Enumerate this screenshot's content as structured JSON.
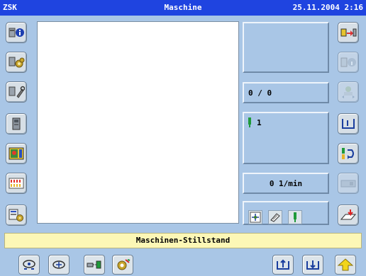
{
  "titlebar": {
    "app": "ZSK",
    "title": "Maschine",
    "datetime": "25.11.2004  2:16"
  },
  "panels": {
    "counter": "0 / 0",
    "needle": "1",
    "speed": "0 1/min"
  },
  "status": "Maschinen-Stillstand",
  "icons": {
    "left": [
      "machine-info-icon",
      "machine-gears-icon",
      "machine-service-icon",
      "memory-card-icon",
      "design-colors-icon",
      "color-sequence-icon",
      "design-settings-icon"
    ],
    "right": [
      "transfer-design-icon",
      "head-info-icon",
      "frame-move-icon",
      "frame-lower-icon",
      "thread-change-icon",
      "boring-device-icon",
      "start-embroidery-icon"
    ],
    "bottom": [
      "frame-center-icon",
      "frame-origin-icon",
      "needle-move-icon",
      "settings-gear-icon",
      "frame-up-icon",
      "frame-down-icon",
      "arrow-up-icon"
    ],
    "mini": [
      "frame-move-small-icon",
      "design-small-icon",
      "needle-small-icon"
    ]
  },
  "colors": {
    "titlebar": "#1f44e0",
    "background": "#a9c6e6",
    "status": "#fcf7b6",
    "needle": "#1f9a3a"
  }
}
